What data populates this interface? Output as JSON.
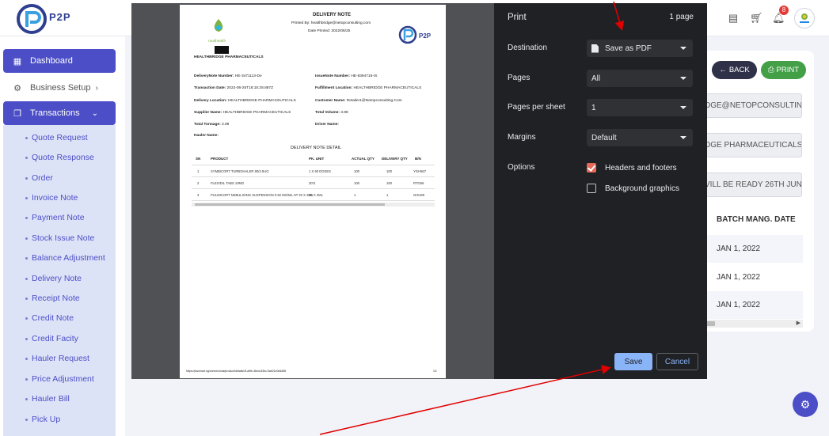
{
  "brand": {
    "logo_text": "P2P",
    "notification_count": "8"
  },
  "sidebar": {
    "dashboard": "Dashboard",
    "business_setup": "Business Setup",
    "transactions": "Transactions",
    "sub_items": [
      "Quote Request",
      "Quote Response",
      "Order",
      "Invoice Note",
      "Payment Note",
      "Stock Issue Note",
      "Balance Adjustment",
      "Delivery Note",
      "Receipt Note",
      "Credit Note",
      "Credit Facity",
      "Hauler Request",
      "Price Adjustment",
      "Hauler Bill",
      "Pick Up"
    ]
  },
  "background_page": {
    "back_label": "BACK",
    "print_label": "PRINT",
    "fields": [
      "DGE@NETOPCONSULTIN",
      "DGE PHARMACEUTICALS",
      "VILL BE READY 26TH JUN"
    ],
    "table_header": "BATCH MANG. DATE",
    "rows": [
      "JAN 1, 2022",
      "JAN 1, 2022",
      "JAN 1, 2022"
    ]
  },
  "preview": {
    "title": "DELIVERY NOTE",
    "printed_by": "Printed By: healthbridge@netopconsulting.com",
    "date_printed": "Date Printed: 2022/06/25",
    "company": "HEALTHBRIDGE PHARMACEUTICALS",
    "logo_small": "nealhealth",
    "fields_left": [
      {
        "label": "DeliveryNote Number:",
        "value": "HE-3471113-De"
      },
      {
        "label": "Transaction Date:",
        "value": "2022-06-25T18:15:28.887Z"
      },
      {
        "label": "Delivery Location:",
        "value": "HEALTHBRIDGE PHARMACEUTICALS"
      },
      {
        "label": "Supplier Name:",
        "value": "HEALTHBRIDGE PHARMACEUTICALS"
      },
      {
        "label": "Total Tonnage:",
        "value": "3.98"
      },
      {
        "label": "Hauler Name:",
        "value": ""
      }
    ],
    "fields_right": [
      {
        "label": "IssueNote Number:",
        "value": "HE-8394716-IS"
      },
      {
        "label": "Fulfillment Location:",
        "value": "HEALTHBRIDGE PHARMACEUTICALS"
      },
      {
        "label": "Customer Name:",
        "value": "Retailer1@Netopconsulting.Com"
      },
      {
        "label": "Total Volume:",
        "value": "3.98"
      },
      {
        "label": "Driver Name:",
        "value": ""
      }
    ],
    "detail_title": "DELIVERY NOTE DETAIL",
    "columns": [
      "SN",
      "PRODUCT",
      "PK. UNIT",
      "ACTUAL QTY",
      "DELIVERY QTY",
      "B/N"
    ],
    "rows": [
      [
        "1",
        "SYMBICORT TURBOHALER 80/4.5UG",
        "1 X 60 DOSES",
        "100",
        "100",
        "YGH567"
      ],
      [
        "2",
        "FLEXIDIL TABS 10MG",
        "30'S",
        "100",
        "100",
        "RTG56"
      ],
      [
        "3",
        "PULMICORT NEBULISING SUSPENSION 0.50 MG/ML AP 20 X 2ML",
        "20 X 2ML",
        "1",
        "1",
        "GHU89"
      ]
    ],
    "footer_url": "https://plusmart.ng/connexional/product/details/4f-a9fe-4bed-83bc-5ab21e0c6d58",
    "footer_page": "1/1"
  },
  "print": {
    "title": "Print",
    "page_count": "1 page",
    "destination_label": "Destination",
    "destination_value": "Save as PDF",
    "pages_label": "Pages",
    "pages_value": "All",
    "per_sheet_label": "Pages per sheet",
    "per_sheet_value": "1",
    "margins_label": "Margins",
    "margins_value": "Default",
    "options_label": "Options",
    "headers_footers": "Headers and footers",
    "background_graphics": "Background graphics",
    "save": "Save",
    "cancel": "Cancel"
  },
  "colors": {
    "accent": "#4b4ec6",
    "dialog_bg": "#202124",
    "save_blue": "#8ab4f8",
    "annotation_red": "#e00000"
  }
}
